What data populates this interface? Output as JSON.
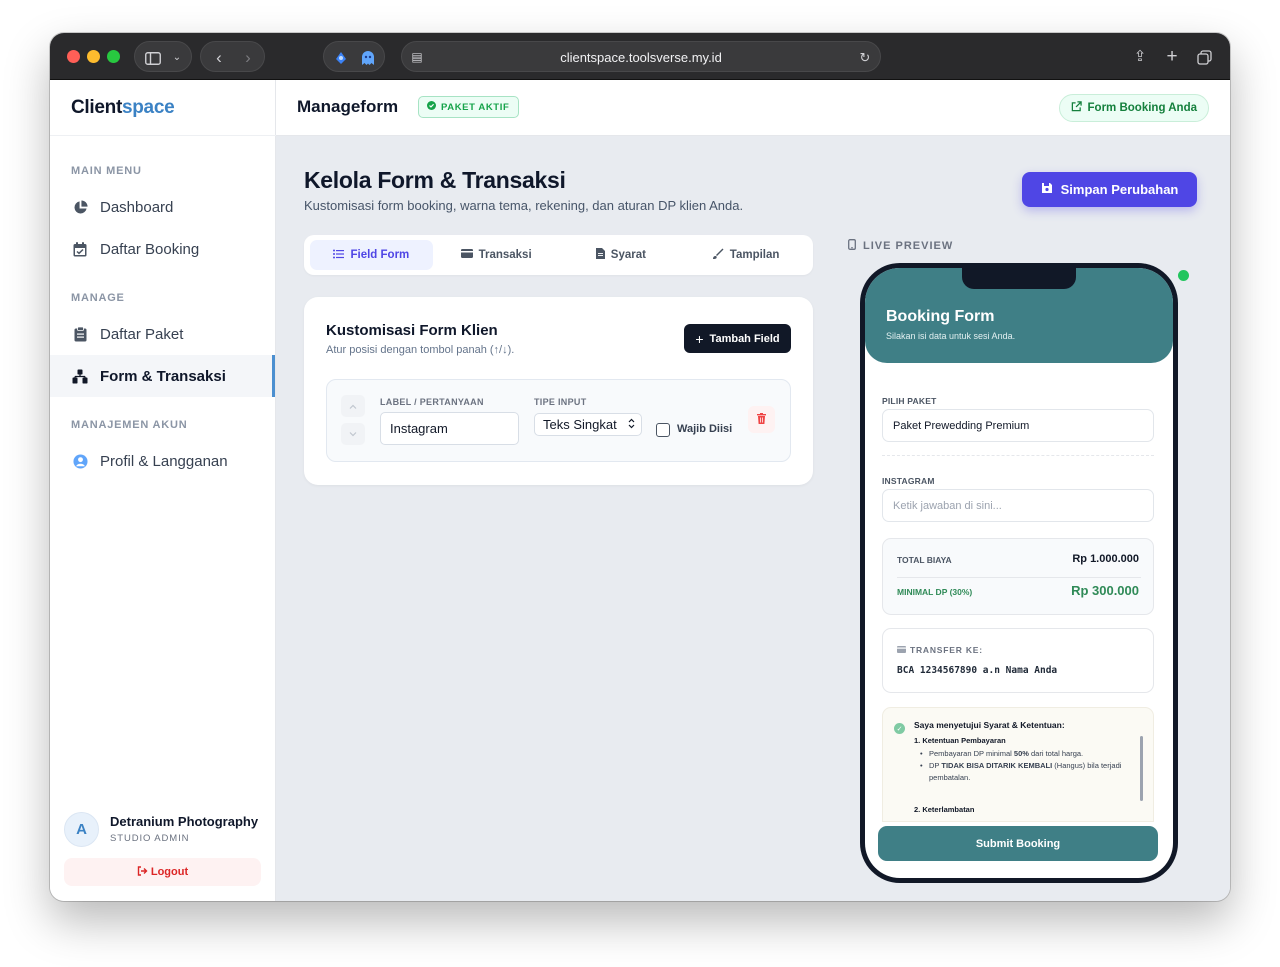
{
  "browser": {
    "url": "clientspace.toolsverse.my.id",
    "colors": {
      "close": "#ff5f57",
      "minimize": "#febc2e",
      "zoom": "#28c840"
    }
  },
  "brand": {
    "part1": "Client",
    "part2": "space",
    "accent": "#3b82c4"
  },
  "sidebar": {
    "sections": [
      {
        "label": "MAIN MENU",
        "items": [
          {
            "label": "Dashboard",
            "icon": "pie-chart-icon"
          },
          {
            "label": "Daftar Booking",
            "icon": "calendar-icon"
          }
        ]
      },
      {
        "label": "MANAGE",
        "items": [
          {
            "label": "Daftar Paket",
            "icon": "clipboard-icon"
          },
          {
            "label": "Form & Transaksi",
            "icon": "form-icon",
            "active": true
          }
        ]
      },
      {
        "label": "MANAJEMEN AKUN",
        "items": [
          {
            "label": "Profil & Langganan",
            "icon": "user-circle-icon"
          }
        ]
      }
    ],
    "user": {
      "initial": "A",
      "name": "Detranium Photography",
      "role": "STUDIO ADMIN"
    },
    "logout_label": "Logout"
  },
  "header": {
    "title": "Manageform",
    "badge": "PAKET AKTIF",
    "link_label": "Form Booking Anda"
  },
  "main": {
    "title": "Kelola Form & Transaksi",
    "subtitle": "Kustomisasi form booking, warna tema, rekening, dan aturan DP klien Anda.",
    "save_label": "Simpan Perubahan",
    "tabs": [
      {
        "label": "Field Form",
        "icon": "list-icon",
        "active": true
      },
      {
        "label": "Transaksi",
        "icon": "card-icon"
      },
      {
        "label": "Syarat",
        "icon": "document-icon"
      },
      {
        "label": "Tampilan",
        "icon": "brush-icon"
      }
    ],
    "card": {
      "title": "Kustomisasi Form Klien",
      "subtitle": "Atur posisi dengan tombol panah (↑/↓).",
      "add_label": "Tambah Field",
      "field": {
        "label_caption": "LABEL / PERTANYAAN",
        "label_value": "Instagram",
        "type_caption": "TIPE INPUT",
        "type_value": "Teks Singkat",
        "required_label": "Wajib Diisi",
        "required": false
      }
    }
  },
  "preview": {
    "label": "LIVE PREVIEW",
    "status_color": "#22c55e",
    "theme_color": "#3f7f86",
    "form_title": "Booking Form",
    "form_subtitle": "Silakan isi data untuk sesi Anda.",
    "package_label": "PILIH PAKET",
    "package_value": "Paket Prewedding Premium",
    "instagram_label": "INSTAGRAM",
    "instagram_placeholder": "Ketik jawaban di sini...",
    "total_label": "TOTAL BIAYA",
    "total_value": "Rp 1.000.000",
    "dp_label": "MINIMAL DP (30%)",
    "dp_value": "Rp 300.000",
    "transfer_label": "TRANSFER KE:",
    "transfer_value": "BCA 1234567890 a.n Nama Anda",
    "terms_title": "Saya menyetujui Syarat & Ketentuan:",
    "terms_heading_1": "1. Ketentuan Pembayaran",
    "terms_b1_pre": "Pembayaran DP minimal ",
    "terms_b1_bold": "50%",
    "terms_b1_post": " dari total harga.",
    "terms_b2_pre": "DP ",
    "terms_b2_bold": "TIDAK BISA DITARIK KEMBALI",
    "terms_b2_post": " (Hangus) bila terjadi pembatalan.",
    "terms_heading_2": "2. Keterlambatan",
    "submit_label": "Submit Booking"
  }
}
